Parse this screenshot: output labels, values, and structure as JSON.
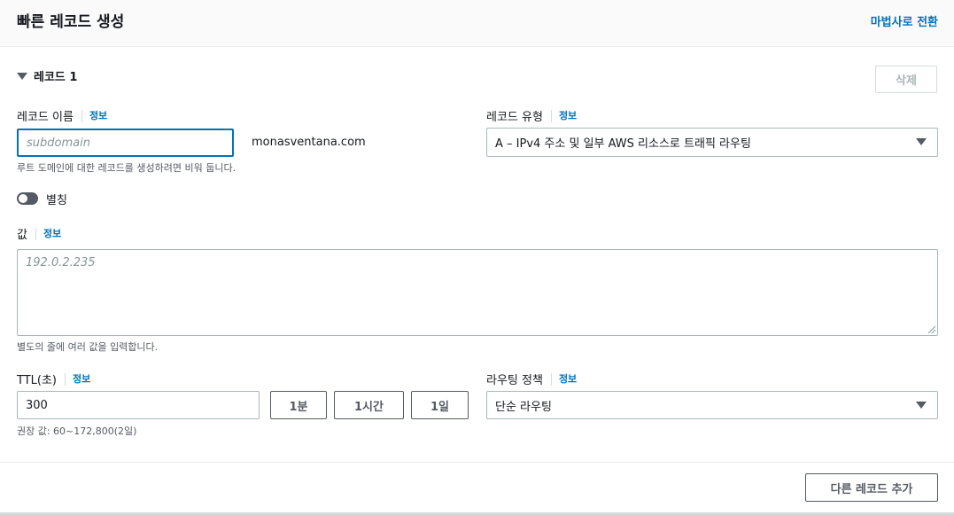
{
  "header": {
    "title": "빠른 레코드 생성",
    "wizard_link": "마법사로 전환"
  },
  "record": {
    "section_title": "레코드 1",
    "delete_button": "삭제",
    "info_label": "정보",
    "name": {
      "label": "레코드 이름",
      "placeholder": "subdomain",
      "value": "",
      "domain_suffix": "monasventana.com",
      "hint": "루트 도메인에 대한 레코드를 생성하려면 비워 둡니다."
    },
    "type": {
      "label": "레코드 유형",
      "selected": "A – IPv4 주소 및 일부 AWS 리소스로 트래픽 라우팅"
    },
    "alias": {
      "label": "별칭",
      "enabled": false
    },
    "value": {
      "label": "값",
      "placeholder": "192.0.2.235",
      "hint": "별도의 줄에 여러 값을 입력합니다."
    },
    "ttl": {
      "label": "TTL(초)",
      "value": "300",
      "presets": [
        "1분",
        "1시간",
        "1일"
      ],
      "hint": "권장 값: 60~172,800(2일)"
    },
    "routing_policy": {
      "label": "라우팅 정책",
      "selected": "단순 라우팅"
    }
  },
  "footer": {
    "add_record_button": "다른 레코드 추가"
  }
}
